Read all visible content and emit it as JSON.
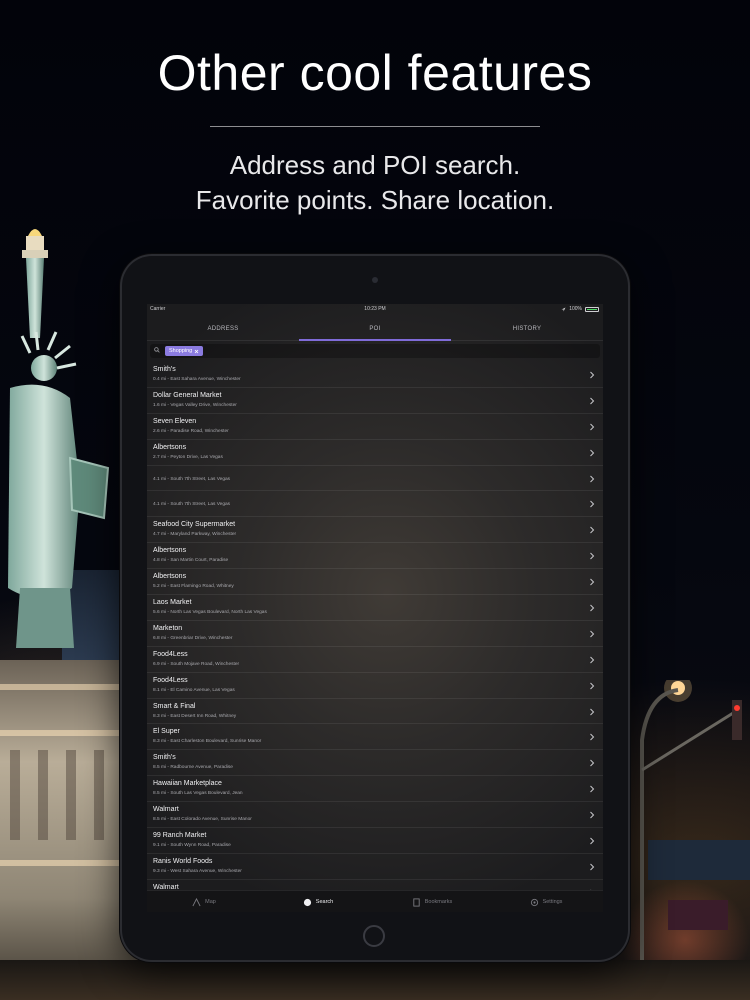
{
  "promo": {
    "headline": "Other cool features",
    "subline1": "Address and POI search.",
    "subline2": "Favorite points. Share location."
  },
  "statusbar": {
    "carrier": "Carrier",
    "time": "10:23 PM",
    "battery": "100%"
  },
  "tabs": [
    {
      "label": "ADDRESS",
      "active": false
    },
    {
      "label": "POI",
      "active": true
    },
    {
      "label": "HISTORY",
      "active": false
    }
  ],
  "search": {
    "chip_label": "Shopping"
  },
  "results": [
    {
      "name": "Smith's",
      "detail": "0.4 mi - East Sahara Avenue, Winchester"
    },
    {
      "name": "Dollar General Market",
      "detail": "1.6 mi - Vegas Valley Drive, Winchester"
    },
    {
      "name": "Seven Eleven",
      "detail": "2.6 mi - Paradise Road, Winchester"
    },
    {
      "name": "Albertsons",
      "detail": "2.7 mi - Peyton Drive, Las Vegas"
    },
    {
      "name": "",
      "detail": "4.1 mi - South 7th Street, Las Vegas"
    },
    {
      "name": "",
      "detail": "4.1 mi - South 7th Street, Las Vegas"
    },
    {
      "name": "Seafood City Supermarket",
      "detail": "4.7 mi - Maryland Parkway, Winchester"
    },
    {
      "name": "Albertsons",
      "detail": "4.8 mi - San Martin Court, Paradise"
    },
    {
      "name": "Albertsons",
      "detail": "5.2 mi - East Flamingo Road, Whitney"
    },
    {
      "name": "Laos Market",
      "detail": "5.6 mi - North Las Vegas Boulevard, North Las Vegas"
    },
    {
      "name": "Marketon",
      "detail": "6.8 mi - Greenbriar Drive, Winchester"
    },
    {
      "name": "Food4Less",
      "detail": "6.9 mi - South Mojave Road, Winchester"
    },
    {
      "name": "Food4Less",
      "detail": "8.1 mi - El Camino Avenue, Las Vegas"
    },
    {
      "name": "Smart & Final",
      "detail": "8.3 mi - East Desert Inn Road, Whitney"
    },
    {
      "name": "El Super",
      "detail": "8.3 mi - East Charleston Boulevard, Sunrise Manor"
    },
    {
      "name": "Smith's",
      "detail": "8.5 mi - Radbourne Avenue, Paradise"
    },
    {
      "name": "Hawaiian Marketplace",
      "detail": "8.5 mi - South Las Vegas Boulevard, Jean"
    },
    {
      "name": "Walmart",
      "detail": "8.5 mi - East Colorado Avenue, Sunrise Manor"
    },
    {
      "name": "99 Ranch Market",
      "detail": "9.1 mi - South Wynn Road, Paradise"
    },
    {
      "name": "Ranis World Foods",
      "detail": "9.3 mi - West Sahara Avenue, Winchester"
    },
    {
      "name": "Walmart",
      "detail": ""
    }
  ],
  "bottom_tabs": [
    {
      "label": "Map",
      "icon": "map-pin-icon",
      "active": false
    },
    {
      "label": "Search",
      "icon": "search-icon",
      "active": true
    },
    {
      "label": "Bookmarks",
      "icon": "bookmark-icon",
      "active": false
    },
    {
      "label": "Settings",
      "icon": "gear-icon",
      "active": false
    }
  ],
  "colors": {
    "accent": "#7f6bd8",
    "chip": "#8b7be0",
    "battery": "#4cd964"
  }
}
